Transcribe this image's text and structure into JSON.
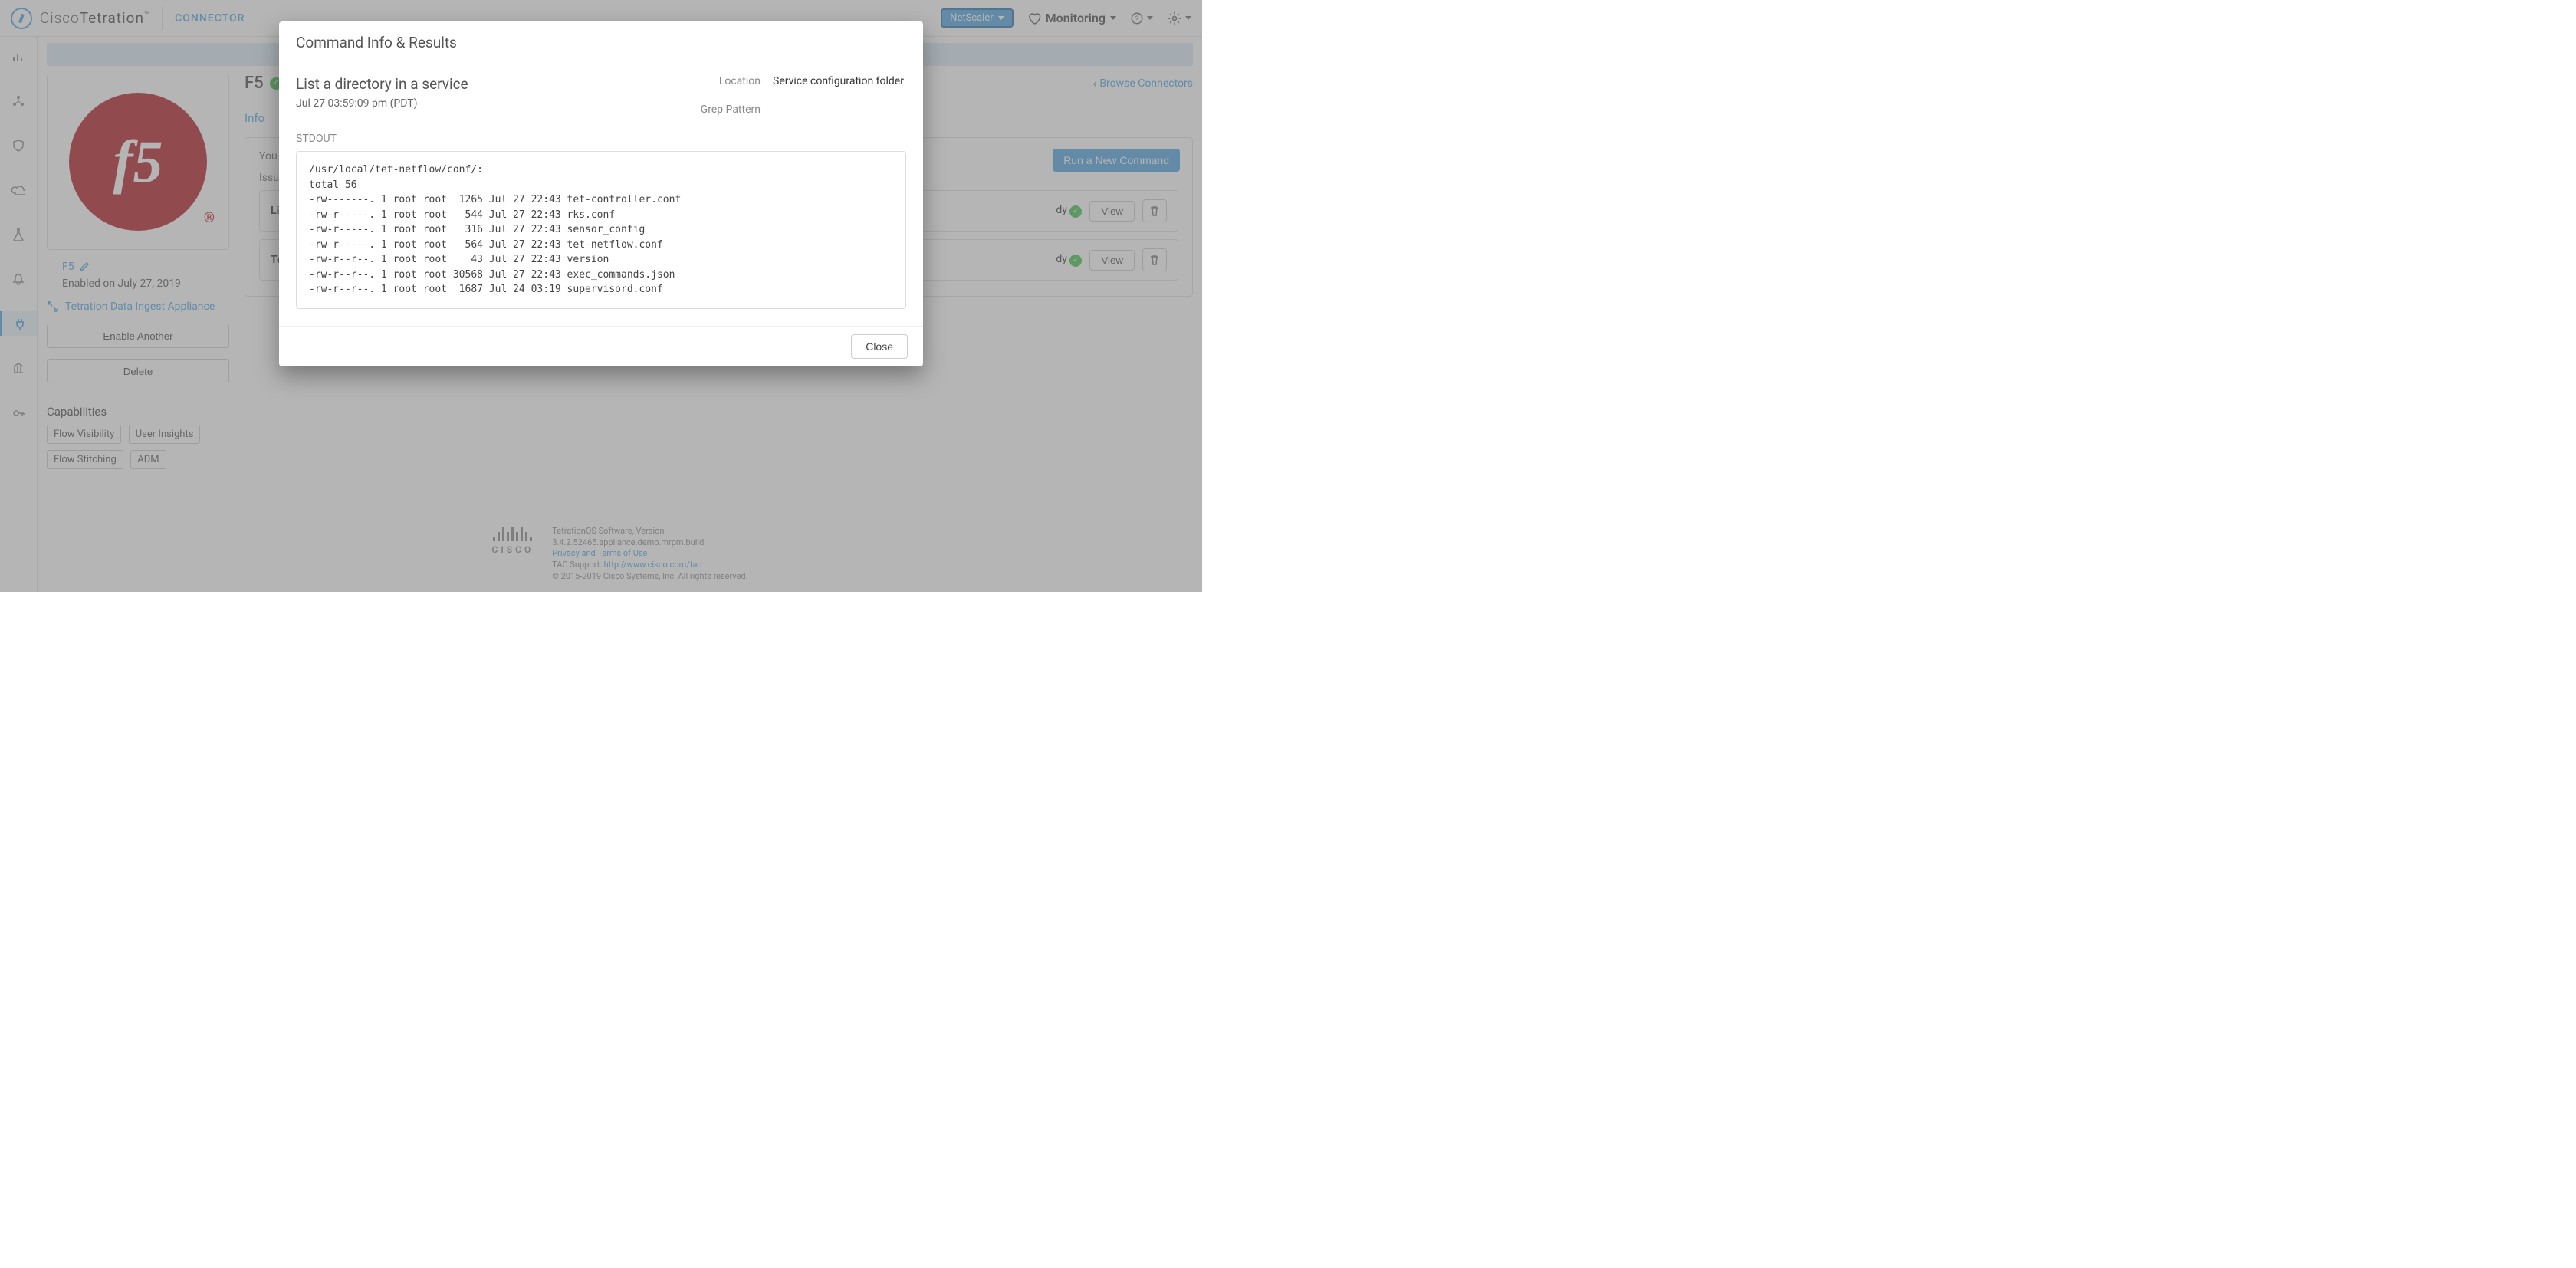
{
  "topnav": {
    "brand_prefix": "Cisco",
    "brand_suffix": "Tetration",
    "connector_label": "CONNECTOR",
    "tenant_button": "NetScaler",
    "monitoring_label": "Monitoring"
  },
  "leftrail": {
    "items": [
      {
        "name": "chart-icon"
      },
      {
        "name": "topology-icon"
      },
      {
        "name": "shield-icon"
      },
      {
        "name": "cloud-icon"
      },
      {
        "name": "flask-icon"
      },
      {
        "name": "bell-icon"
      },
      {
        "name": "plug-icon",
        "active": true
      },
      {
        "name": "bank-icon"
      },
      {
        "name": "key-icon"
      }
    ]
  },
  "side": {
    "connector_name": "F5",
    "enabled_text": "Enabled on July 27, 2019",
    "ingest_link": "Tetration Data Ingest Appliance",
    "enable_another_label": "Enable Another",
    "delete_label": "Delete",
    "capabilities_title": "Capabilities",
    "capabilities": [
      "Flow Visibility",
      "User Insights",
      "Flow Stitching",
      "ADM"
    ]
  },
  "page": {
    "title": "F5",
    "browse_label": "Browse Connectors",
    "tab_info": "Info",
    "panel_hint_prefix": "You m",
    "run_button": "Run a New Command",
    "issued_label_prefix": "Issue",
    "rows": [
      {
        "label_prefix": "Lis",
        "status_prefix": "dy",
        "view": "View"
      },
      {
        "label_prefix": "Te",
        "status_prefix": "dy",
        "view": "View"
      }
    ]
  },
  "footer": {
    "cisco_word": "CISCO",
    "line1": "TetrationOS Software, Version",
    "line2": "3.4.2.52465.appliance.demo.mrpm.build",
    "privacy": "Privacy and Terms of Use",
    "tac_prefix": "TAC Support: ",
    "tac_url": "http://www.cisco.com/tac",
    "copyright": "© 2015-2019 Cisco Systems, Inc. All rights reserved."
  },
  "modal": {
    "title": "Command Info & Results",
    "command_name": "List a directory in a service",
    "timestamp": "Jul 27 03:59:09 pm (PDT)",
    "location_label": "Location",
    "location_value": "Service configuration folder",
    "grep_label": "Grep Pattern",
    "grep_value": "",
    "stdout_label": "STDOUT",
    "stdout": "/usr/local/tet-netflow/conf/:\ntotal 56\n-rw-------. 1 root root  1265 Jul 27 22:43 tet-controller.conf\n-rw-r-----. 1 root root   544 Jul 27 22:43 rks.conf\n-rw-r-----. 1 root root   316 Jul 27 22:43 sensor_config\n-rw-r-----. 1 root root   564 Jul 27 22:43 tet-netflow.conf\n-rw-r--r--. 1 root root    43 Jul 27 22:43 version\n-rw-r--r--. 1 root root 30568 Jul 27 22:43 exec_commands.json\n-rw-r--r--. 1 root root  1687 Jul 24 03:19 supervisord.conf",
    "close_label": "Close"
  }
}
